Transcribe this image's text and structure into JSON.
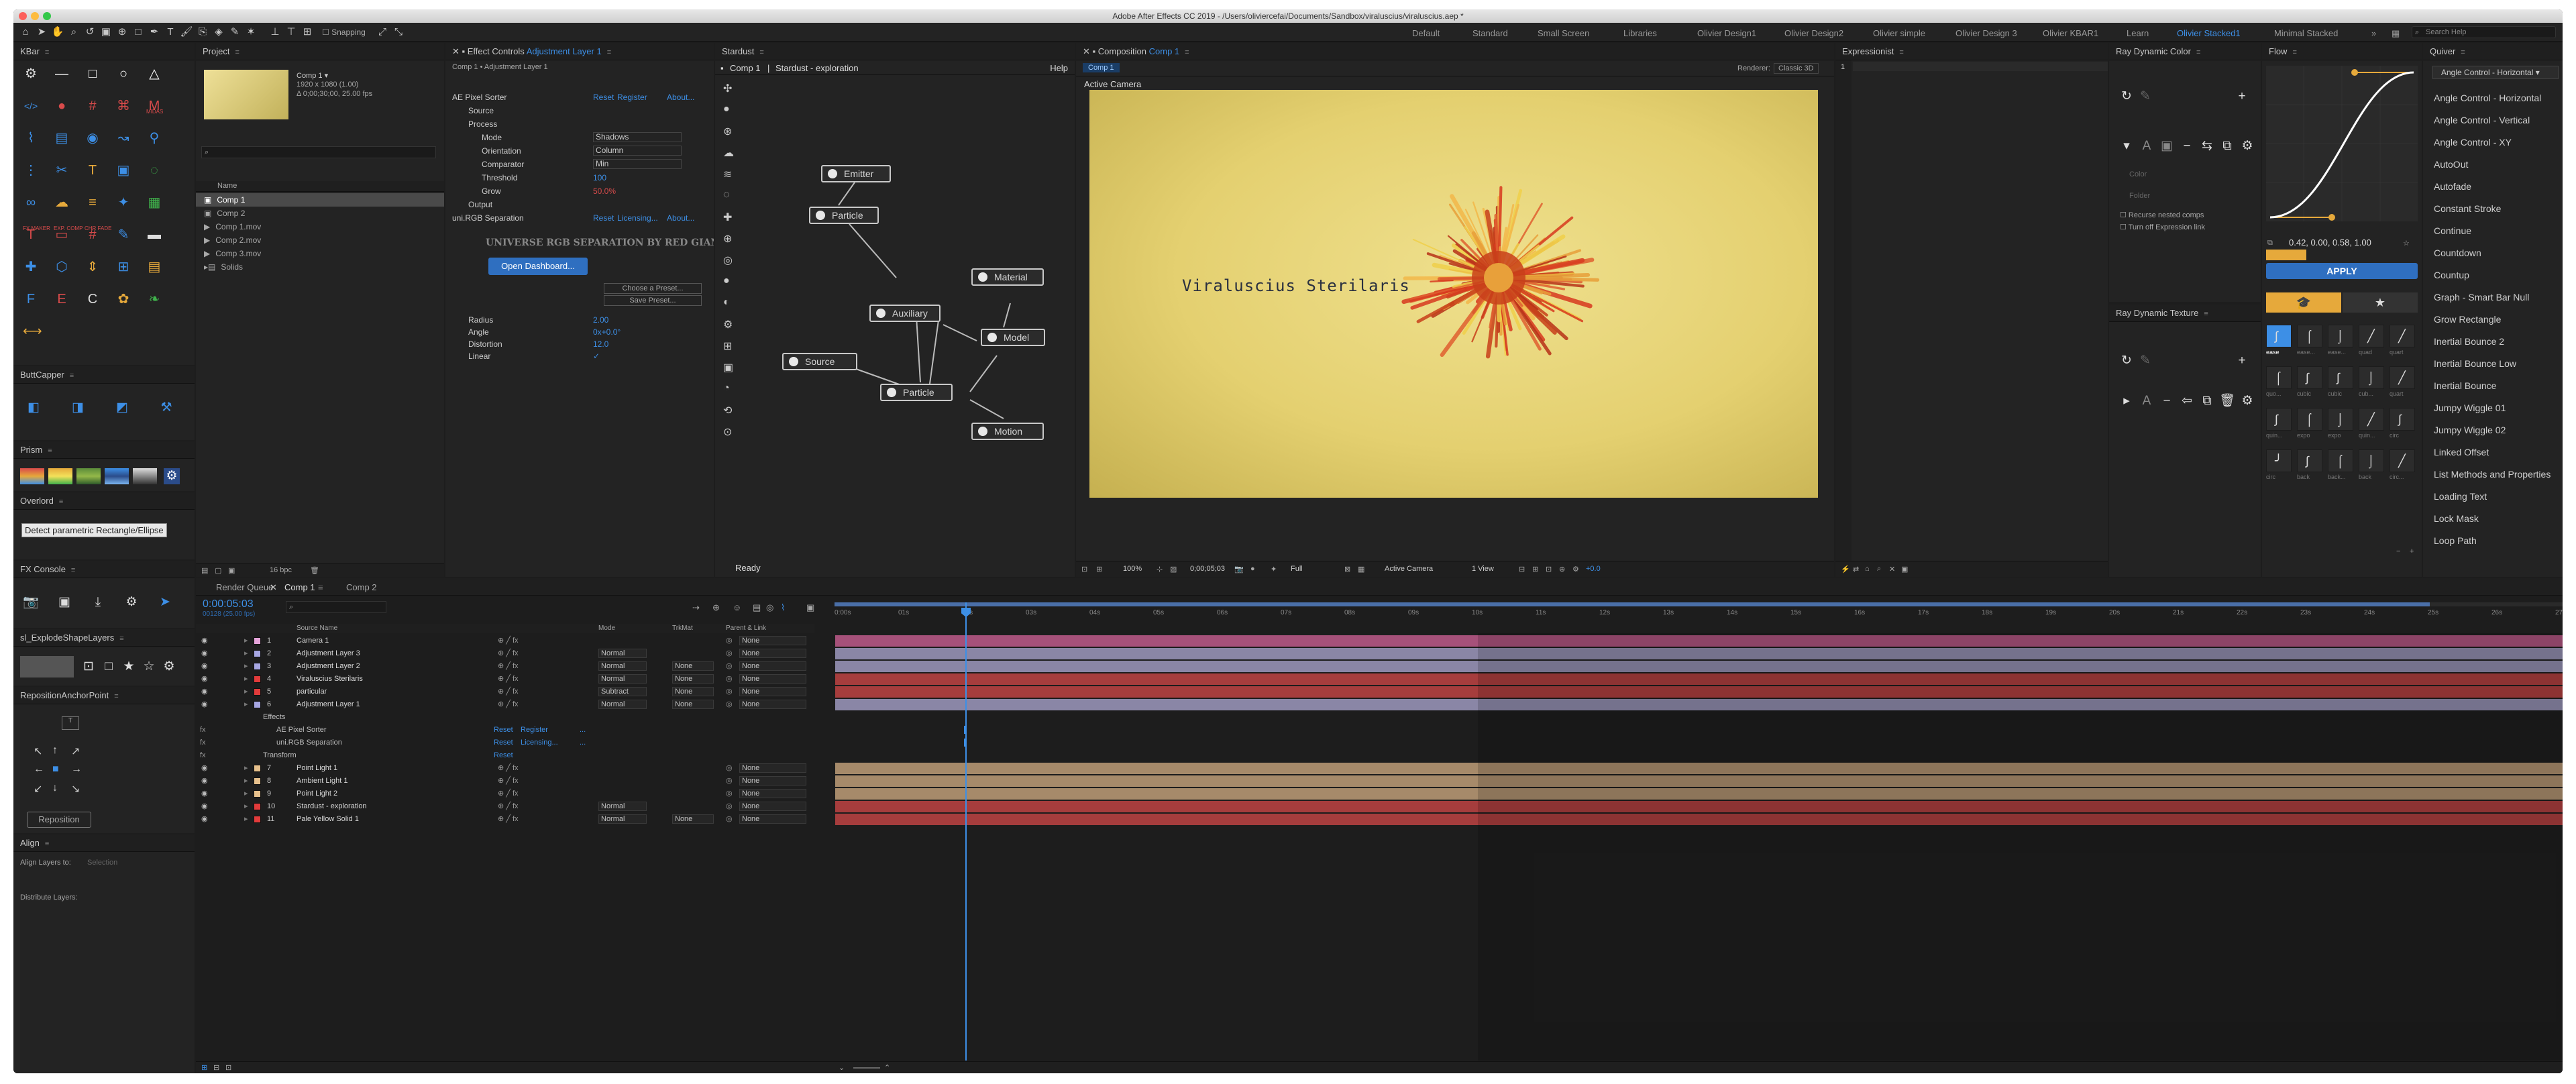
{
  "title": "Adobe After Effects CC 2019 - /Users/oliviercefai/Documents/Sandbox/viraluscius/viraluscius.aep *",
  "toolbar": {
    "snapping": "Snapping",
    "search_placeholder": "Search Help",
    "workspaces": [
      "Default",
      "Standard",
      "Small Screen",
      "Libraries",
      "Olivier Design1",
      "Olivier Design2",
      "Olivier simple",
      "Olivier Design 3",
      "Olivier KBAR1",
      "Learn",
      "Olivier Stacked1",
      "Minimal Stacked"
    ],
    "active_workspace": "Olivier Stacked1"
  },
  "kbar": {
    "title": "KBar",
    "labels": [
      "MIDAS",
      "FX MAKER",
      "EXP. COMP",
      "CHR FADE"
    ]
  },
  "buttcapper": {
    "title": "ButtCapper"
  },
  "prism": {
    "title": "Prism"
  },
  "overlord": {
    "title": "Overlord",
    "tooltip": "Detect parametric Rectangle/Ellipse"
  },
  "fxconsole": {
    "title": "FX Console"
  },
  "explode": {
    "title": "sl_ExplodeShapeLayers"
  },
  "reposition": {
    "title": "RepositionAnchorPoint",
    "button": "Reposition"
  },
  "align": {
    "title": "Align",
    "align_to": "Align Layers to:",
    "selection": "Selection",
    "distribute": "Distribute Layers:"
  },
  "project": {
    "title": "Project",
    "comp_name": "Comp 1 ▾",
    "comp_info": "1920 x 1080 (1.00)",
    "comp_dur": "Δ 0;00;30;00, 25.00 fps",
    "name_col": "Name",
    "bpc": "16 bpc",
    "items": [
      "Comp 1",
      "Comp 2",
      "Comp 1.mov",
      "Comp 2.mov",
      "Comp 3.mov",
      "Solids"
    ]
  },
  "effects": {
    "title": "Effect Controls",
    "layer": "Adjustment Layer 1",
    "path": "Comp 1 • Adjustment Layer 1",
    "rows": [
      {
        "label": "AE Pixel Sorter",
        "a": "Reset",
        "b": "Register",
        "c": "About..."
      },
      {
        "label": "Source"
      },
      {
        "label": "Process"
      },
      {
        "label": "Mode",
        "v": "Shadows"
      },
      {
        "label": "Orientation",
        "v": "Column"
      },
      {
        "label": "Comparator",
        "v": "Min"
      },
      {
        "label": "Threshold",
        "v": "100"
      },
      {
        "label": "Grow",
        "v": "50.0%"
      },
      {
        "label": "Output"
      },
      {
        "label": "uni.RGB Separation",
        "a": "Reset",
        "b": "Licensing...",
        "c": "About..."
      }
    ],
    "banner": "UNIVERSE RGB SEPARATION BY RED GIANT",
    "dashboard": "Open Dashboard...",
    "choose": "Choose a Preset...",
    "save": "Save Preset...",
    "params": [
      {
        "label": "Radius",
        "v": "2.00"
      },
      {
        "label": "Angle",
        "v": "0x+0.0°"
      },
      {
        "label": "Distortion",
        "v": "12.0"
      },
      {
        "label": "Linear",
        "v": "✓"
      }
    ]
  },
  "stardust": {
    "title": "Stardust",
    "comp": "Comp 1",
    "name": "Stardust - exploration",
    "help": "Help",
    "ready": "Ready",
    "nodes": [
      "Emitter",
      "Particle",
      "Material",
      "Auxiliary",
      "Model",
      "Source",
      "Particle",
      "Motion"
    ]
  },
  "composition": {
    "title": "Composition",
    "comp": "Comp 1",
    "tab": "Comp 1",
    "renderer_label": "Renderer:",
    "renderer": "Classic 3D",
    "camera": "Active Camera",
    "text": "Viraluscius Sterilaris",
    "zoom": "100%",
    "time": "0;00;05;03",
    "quality": "Full",
    "view_camera": "Active Camera",
    "views": "1 View",
    "offset": "+0.0"
  },
  "expressionist": {
    "title": "Expressionist",
    "line": "1"
  },
  "raycolor": {
    "title": "Ray Dynamic Color",
    "color": "Color",
    "folder": "Folder",
    "opt1": "Recurse nested comps",
    "opt2": "Turn off Expression link"
  },
  "raytexture": {
    "title": "Ray Dynamic Texture"
  },
  "flow": {
    "title": "Flow",
    "values": "0.42, 0.00, 0.58, 1.00",
    "apply": "APPLY",
    "preset": "ease",
    "labels": [
      "ease",
      "ease...",
      "ease...",
      "quad",
      "quart",
      "quo...",
      "cubic",
      "cubic",
      "cub...",
      "quart",
      "quin...",
      "expo",
      "expo",
      "quin...",
      "circ",
      "circ",
      "back",
      "back...",
      "back",
      "circ..."
    ]
  },
  "quiver": {
    "title": "Quiver",
    "selected": "Angle Control - Horizontal",
    "items": [
      "Angle Control - Horizontal",
      "Angle Control - Vertical",
      "Angle Control - XY",
      "AutoOut",
      "Autofade",
      "Constant Stroke",
      "Continue",
      "Countdown",
      "Countup",
      "Graph - Smart Bar Null",
      "Grow Rectangle",
      "Inertial Bounce 2",
      "Inertial Bounce Low",
      "Inertial Bounce",
      "Jumpy Wiggle 01",
      "Jumpy Wiggle 02",
      "Linked Offset",
      "List Methods and Properties",
      "Loading Text",
      "Lock Mask",
      "Loop Path"
    ]
  },
  "timeline": {
    "tabs": [
      "Render Queue",
      "Comp 1",
      "Comp 2"
    ],
    "time": "0:00:05:03",
    "frames": "00128 (25.00 fps)",
    "cols": {
      "src": "Source Name",
      "mode": "Mode",
      "trkmat": "TrkMat",
      "parent": "Parent & Link"
    },
    "ticks": [
      "0:00s",
      "01s",
      "02s",
      "03s",
      "04s",
      "05s",
      "06s",
      "07s",
      "08s",
      "09s",
      "10s",
      "11s",
      "12s",
      "13s",
      "14s",
      "15s",
      "16s",
      "17s",
      "18s",
      "19s",
      "20s",
      "21s",
      "22s",
      "23s",
      "24s",
      "25s",
      "26s",
      "27s"
    ],
    "layers": [
      {
        "n": "1",
        "name": "Camera 1",
        "color": "#e4a3d9",
        "mode": "",
        "trk": "",
        "parent": "None",
        "bar": "#a6517a"
      },
      {
        "n": "2",
        "name": "Adjustment Layer 3",
        "color": "#a7a7e3",
        "mode": "Normal",
        "trk": "",
        "parent": "None",
        "bar": "#8a86a6"
      },
      {
        "n": "3",
        "name": "Adjustment Layer 2",
        "color": "#a7a7e3",
        "mode": "Normal",
        "trk": "None",
        "parent": "None",
        "bar": "#8a86a6"
      },
      {
        "n": "4",
        "name": "Viraluscius Sterilaris",
        "color": "#e23b3b",
        "mode": "Normal",
        "trk": "None",
        "parent": "None",
        "bar": "#a63d3d"
      },
      {
        "n": "5",
        "name": "particular",
        "color": "#e23b3b",
        "mode": "Subtract",
        "trk": "None",
        "parent": "None",
        "bar": "#a63d3d"
      },
      {
        "n": "6",
        "name": "Adjustment Layer 1",
        "color": "#a7a7e3",
        "mode": "Normal",
        "trk": "None",
        "parent": "None",
        "bar": "#8a86a6"
      }
    ],
    "sub": [
      {
        "label": "Effects"
      },
      {
        "label": "AE Pixel Sorter",
        "a": "Reset",
        "b": "Register",
        "c": "..."
      },
      {
        "label": "uni.RGB Separation",
        "a": "Reset",
        "b": "Licensing...",
        "c": "..."
      },
      {
        "label": "Transform",
        "a": "Reset"
      }
    ],
    "layers2": [
      {
        "n": "7",
        "name": "Point Light 1",
        "color": "#e6c08c",
        "mode": "",
        "trk": "",
        "parent": "None",
        "bar": "#a68a6a"
      },
      {
        "n": "8",
        "name": "Ambient Light 1",
        "color": "#e6c08c",
        "mode": "",
        "trk": "",
        "parent": "None",
        "bar": "#a68a6a"
      },
      {
        "n": "9",
        "name": "Point Light 2",
        "color": "#e6c08c",
        "mode": "",
        "trk": "",
        "parent": "None",
        "bar": "#a68a6a"
      },
      {
        "n": "10",
        "name": "Stardust - exploration",
        "color": "#e23b3b",
        "mode": "Normal",
        "trk": "",
        "parent": "None",
        "bar": "#a63d3d"
      },
      {
        "n": "11",
        "name": "Pale Yellow Solid 1",
        "color": "#e23b3b",
        "mode": "Normal",
        "trk": "None",
        "parent": "None",
        "bar": "#a63d3d"
      }
    ]
  }
}
